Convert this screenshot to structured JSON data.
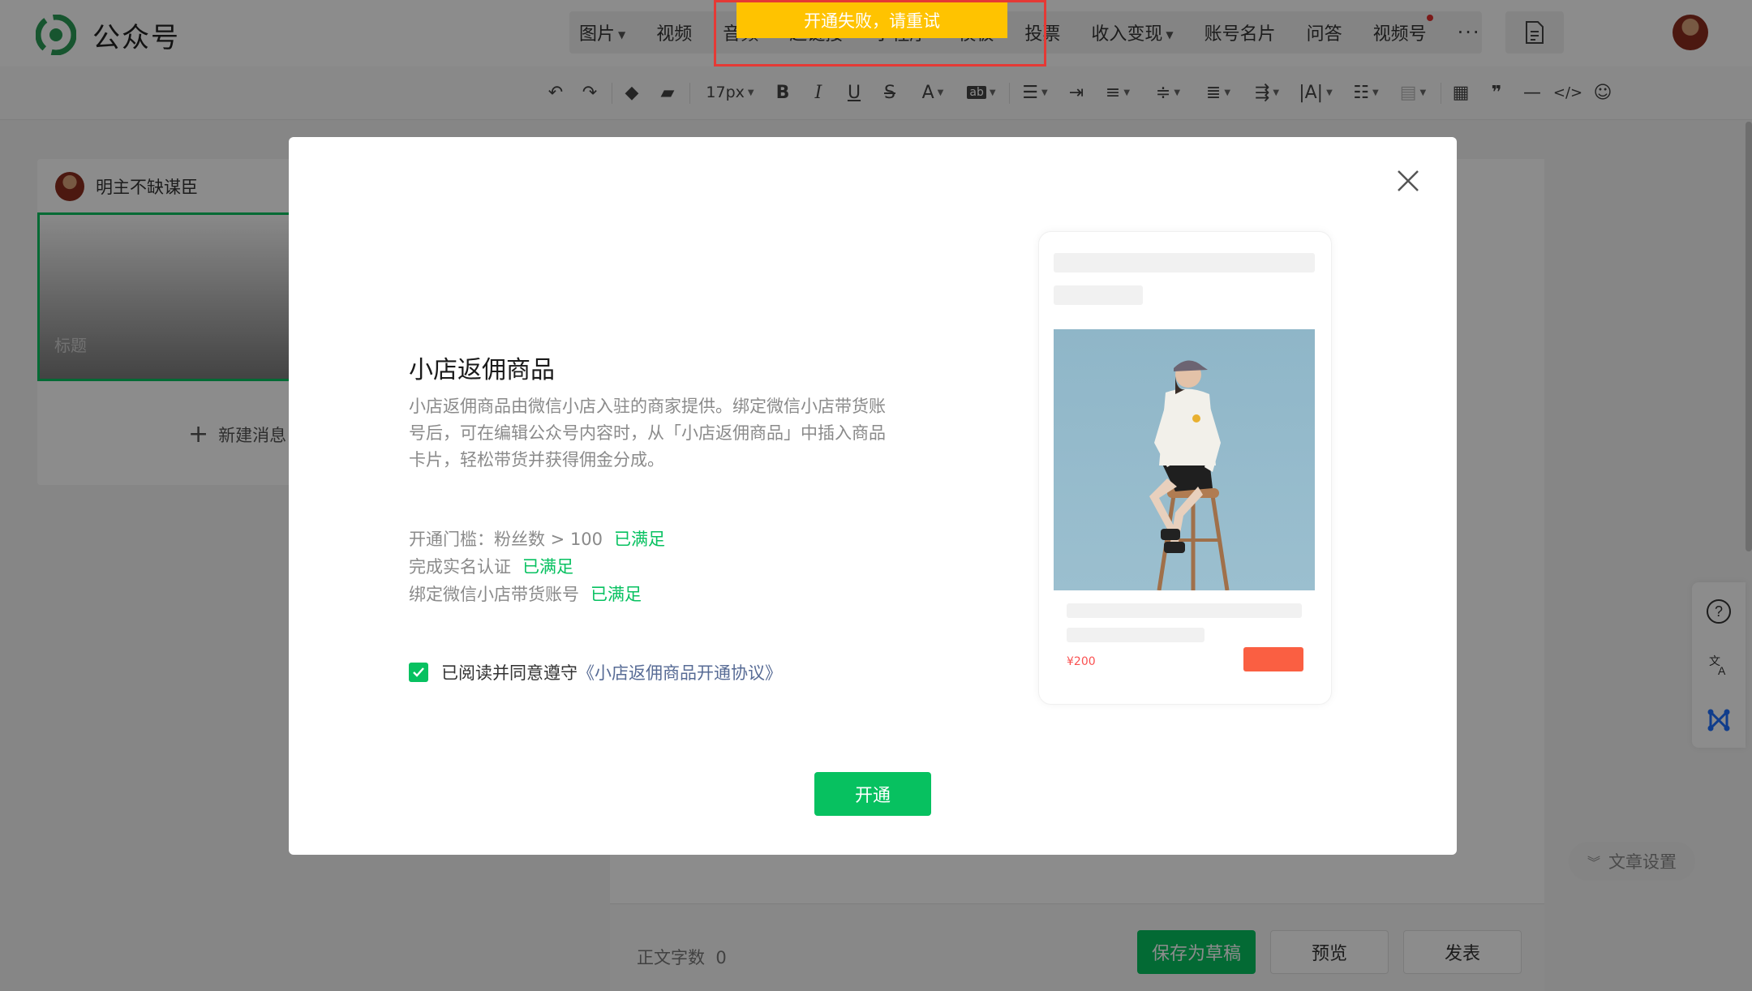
{
  "app": {
    "name": "公众号"
  },
  "menu": {
    "items": [
      {
        "label": "图片",
        "caret": true
      },
      {
        "label": "视频",
        "caret": false
      },
      {
        "label": "音频",
        "caret": false
      },
      {
        "label": "超链接",
        "caret": false
      },
      {
        "label": "小程序",
        "caret": false
      },
      {
        "label": "模板",
        "caret": false
      },
      {
        "label": "投票",
        "caret": false
      },
      {
        "label": "收入变现",
        "caret": true
      },
      {
        "label": "账号名片",
        "caret": false
      },
      {
        "label": "问答",
        "caret": false
      },
      {
        "label": "视频号",
        "caret": false,
        "badge": true
      }
    ],
    "more": "···"
  },
  "toolbar": {
    "font_size": "17px"
  },
  "article_list": {
    "author": "明主不缺谋臣",
    "cover_title_placeholder": "标题",
    "new_message": "新建消息"
  },
  "footer": {
    "wordcount_label": "正文字数",
    "wordcount_value": "0",
    "save_draft": "保存为草稿",
    "preview": "预览",
    "publish": "发表",
    "article_settings": "文章设置"
  },
  "toast": {
    "message": "开通失败，请重试"
  },
  "modal": {
    "title": "小店返佣商品",
    "description": "小店返佣商品由微信小店入驻的商家提供。绑定微信小店带货账号后，可在编辑公众号内容时，从「小店返佣商品」中插入商品卡片，轻松带货并获得佣金分成。",
    "requirements": [
      {
        "label": "开通门槛：粉丝数 > 100",
        "status": "已满足"
      },
      {
        "label": "完成实名认证",
        "status": "已满足"
      },
      {
        "label": "绑定微信小店带货账号",
        "status": "已满足"
      }
    ],
    "agreement_prefix": "已阅读并同意遵守",
    "agreement_link": "《小店返佣商品开通协议》",
    "agreement_checked": true,
    "open_button": "开通",
    "preview_price": "¥200"
  },
  "colors": {
    "brand_green": "#07c160",
    "toast_yellow": "#ffc300",
    "link_blue": "#576b95",
    "price_red": "#fa5151"
  }
}
